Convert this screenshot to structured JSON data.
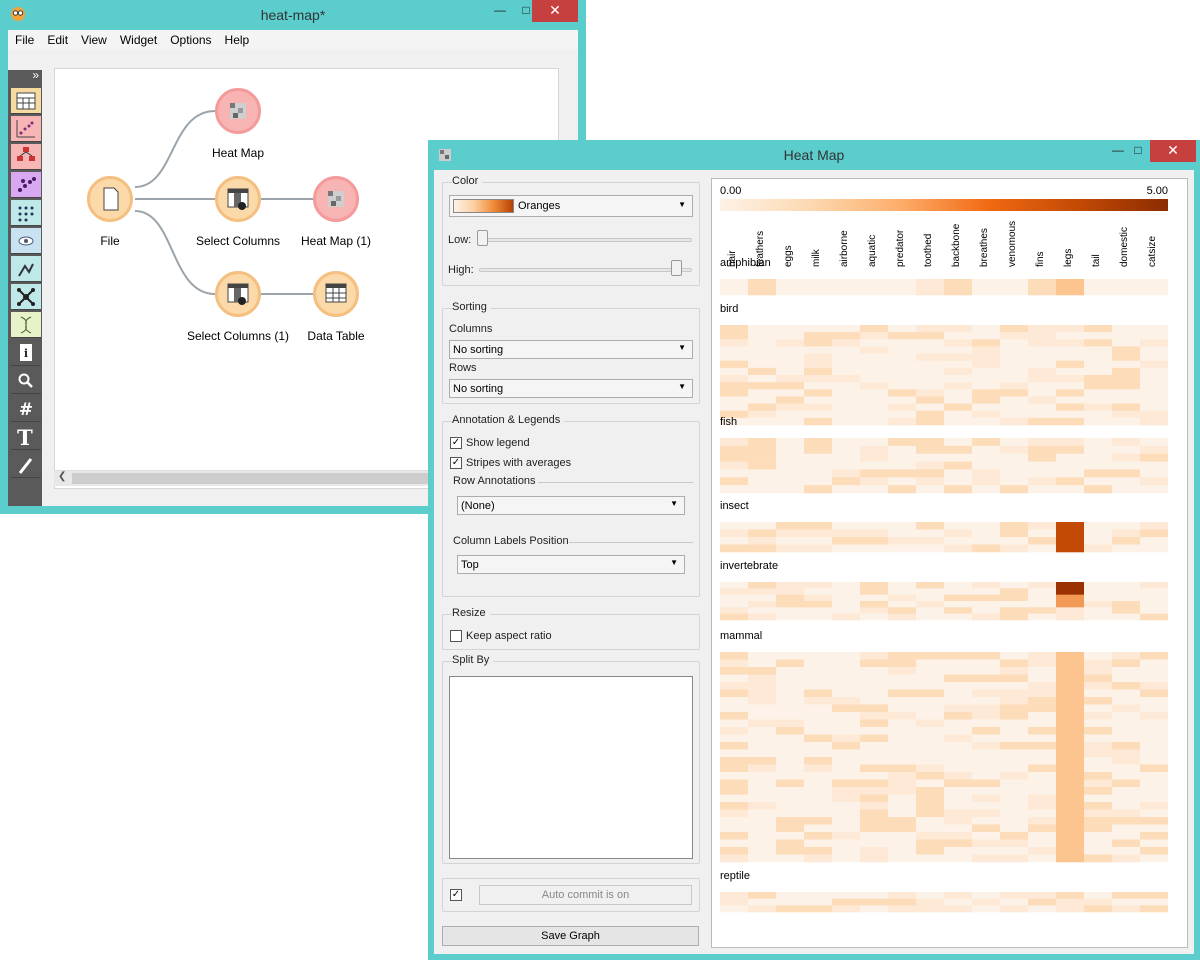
{
  "main_window": {
    "title": "heat-map*",
    "menu": [
      "File",
      "Edit",
      "View",
      "Widget",
      "Options",
      "Help"
    ],
    "toolbox_expand": "»",
    "nodes": {
      "file": "File",
      "heat_map": "Heat Map",
      "select_columns": "Select Columns",
      "heat_map_1": "Heat Map (1)",
      "select_columns_1": "Select Columns (1)",
      "data_table": "Data Table"
    },
    "toolbox_icons": [
      "table-icon",
      "scatter-icon",
      "tree-icon",
      "scatter-dots-icon",
      "grid-plot-icon",
      "eye-icon",
      "explore-icon",
      "network-icon",
      "dna-icon",
      "info-icon",
      "search-icon",
      "hash-icon",
      "text-icon",
      "pen-icon"
    ]
  },
  "heatmap_window": {
    "title": "Heat Map",
    "color": {
      "group": "Color",
      "palette": "Oranges",
      "low_label": "Low:",
      "high_label": "High:",
      "low": 0.0,
      "high": 0.95
    },
    "sorting": {
      "group": "Sorting",
      "columns_label": "Columns",
      "columns_value": "No sorting",
      "rows_label": "Rows",
      "rows_value": "No sorting"
    },
    "annotation": {
      "group": "Annotation & Legends",
      "show_legend": "Show legend",
      "stripes": "Stripes with averages",
      "row_annotations_label": "Row Annotations",
      "row_annotations_value": "(None)",
      "col_labels_label": "Column Labels Position",
      "col_labels_value": "Top"
    },
    "resize": {
      "group": "Resize",
      "keep_aspect": "Keep aspect ratio"
    },
    "split": {
      "group": "Split By"
    },
    "auto_commit": "Auto commit is on",
    "save_graph": "Save Graph",
    "legend": {
      "min": "0.00",
      "max": "5.00"
    },
    "colors": {
      "low": "#fdf2e7",
      "mid": "#fddcb9",
      "high": "#9a3103"
    },
    "columns": [
      "hair",
      "feathers",
      "eggs",
      "milk",
      "airborne",
      "aquatic",
      "predator",
      "toothed",
      "backbone",
      "breathes",
      "venomous",
      "fins",
      "legs",
      "tail",
      "domestic",
      "catsize"
    ],
    "groups": [
      "amphibian",
      "bird",
      "fish",
      "insect",
      "invertebrate",
      "mammal",
      "reptile"
    ]
  }
}
